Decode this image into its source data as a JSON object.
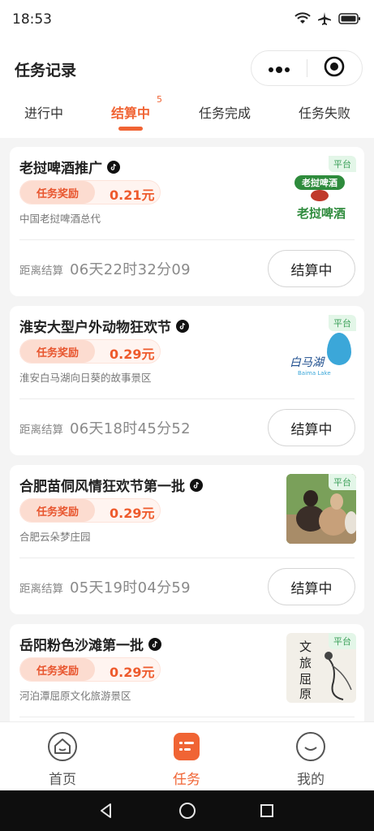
{
  "status_bar": {
    "time": "18:53"
  },
  "header": {
    "title": "任务记录"
  },
  "tabs": [
    {
      "label": "进行中"
    },
    {
      "label": "结算中",
      "badge": "5",
      "active": true
    },
    {
      "label": "任务完成"
    },
    {
      "label": "任务失败"
    }
  ],
  "cards": [
    {
      "title": "老挝啤酒推广",
      "reward_label": "任务奖励",
      "reward_amount": "0.21元",
      "org": "中国老挝啤酒总代",
      "badge": "平台",
      "logo_line1": "老挝啤酒",
      "logo_line2": "老挝啤酒",
      "countdown_label": "距离结算",
      "countdown": "06天22时32分09",
      "status": "结算中"
    },
    {
      "title": "淮安大型户外动物狂欢节",
      "reward_label": "任务奖励",
      "reward_amount": "0.29元",
      "org": "淮安白马湖向日葵的故事景区",
      "badge": "平台",
      "logo_text": "白马湖",
      "logo_sub": "Baima Lake",
      "countdown_label": "距离结算",
      "countdown": "06天18时45分52",
      "status": "结算中"
    },
    {
      "title": "合肥苗侗风情狂欢节第一批",
      "reward_label": "任务奖励",
      "reward_amount": "0.29元",
      "org": "合肥云朵梦庄园",
      "badge": "平台",
      "countdown_label": "距离结算",
      "countdown": "05天19时04分59",
      "status": "结算中"
    },
    {
      "title": "岳阳粉色沙滩第一批",
      "reward_label": "任务奖励",
      "reward_amount": "0.29元",
      "org": "河泊潭屈原文化旅游景区",
      "badge": "平台",
      "logo_chars": [
        "文",
        "旅",
        "屈",
        "原"
      ]
    }
  ],
  "bottom_nav": [
    {
      "label": "首页",
      "icon": "home-icon"
    },
    {
      "label": "任务",
      "icon": "task-icon",
      "active": true
    },
    {
      "label": "我的",
      "icon": "profile-icon"
    }
  ],
  "colors": {
    "accent": "#f06434",
    "badge_green": "#3ea15b",
    "background": "#f4f4f4"
  }
}
